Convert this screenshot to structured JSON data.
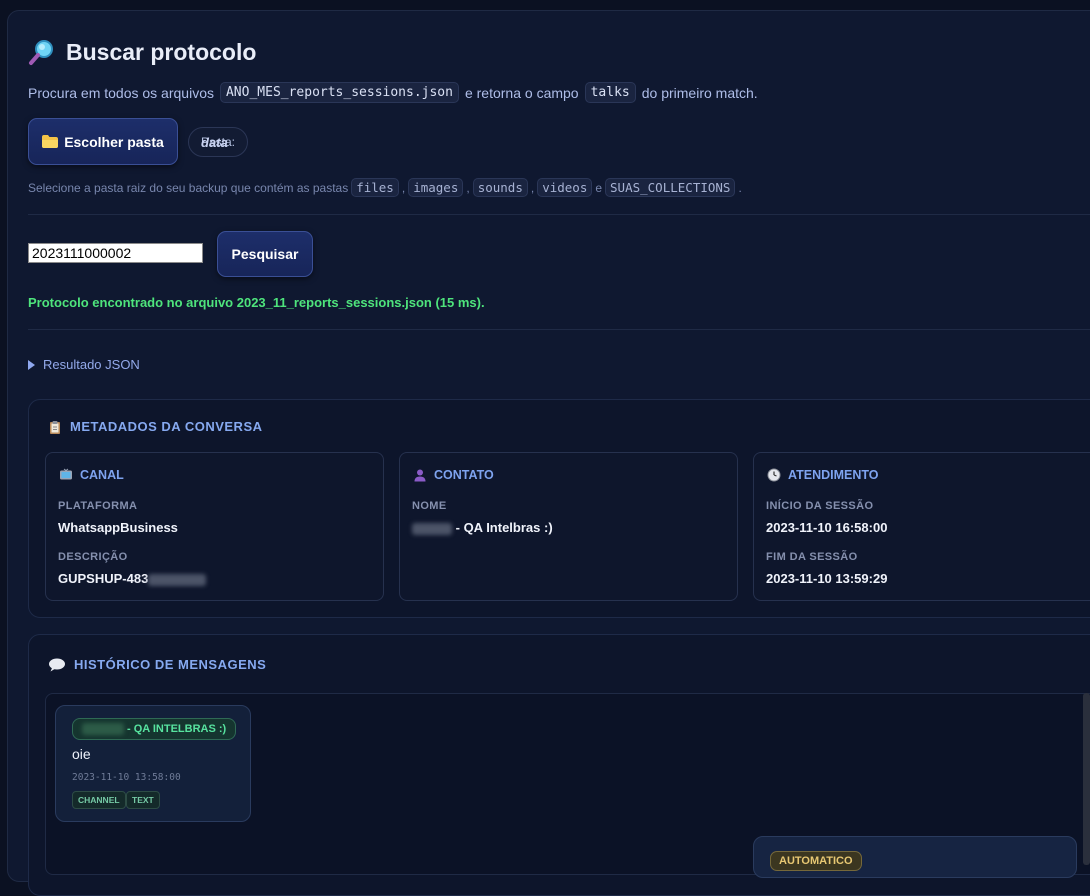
{
  "header": {
    "title": "Buscar protocolo",
    "desc_prefix": "Procura em todos os arquivos",
    "desc_file": "ANO_MES_reports_sessions.json",
    "desc_middle": "e retorna o campo",
    "desc_field": "talks",
    "desc_suffix": "do primeiro match."
  },
  "folder": {
    "button_label": "Escolher pasta",
    "pasta_label": "Pasta:",
    "pasta_value": "data",
    "hint_prefix": "Selecione a pasta raiz do seu backup que contém as pastas",
    "hint_items": [
      "files",
      "images",
      "sounds",
      "videos"
    ],
    "hint_and": "e",
    "hint_last": "SUAS_COLLECTIONS",
    "hint_end": "."
  },
  "search": {
    "value": "2023111000002",
    "button_label": "Pesquisar",
    "status": "Protocolo encontrado no arquivo 2023_11_reports_sessions.json (15 ms)."
  },
  "json_toggle": "Resultado JSON",
  "metadata": {
    "title": "METADADOS DA CONVERSA",
    "canal": {
      "title": "CANAL",
      "plataforma_label": "PLATAFORMA",
      "plataforma_value": "WhatsappBusiness",
      "descricao_label": "DESCRIÇÃO",
      "descricao_value": "GUPSHUP-483"
    },
    "contato": {
      "title": "CONTATO",
      "nome_label": "NOME",
      "nome_value": "- QA Intelbras :)"
    },
    "atendimento": {
      "title": "ATENDIMENTO",
      "inicio_label": "INÍCIO DA SESSÃO",
      "inicio_value": "2023-11-10 16:58:00",
      "fim_label": "FIM DA SESSÃO",
      "fim_value": "2023-11-10 13:59:29"
    }
  },
  "history": {
    "title": "HISTÓRICO DE MENSAGENS",
    "messages": [
      {
        "sender": "- QA INTELBRAS :)",
        "text": "oie",
        "time": "2023-11-10 13:58:00",
        "tags": [
          "CHANNEL",
          "TEXT"
        ]
      },
      {
        "tag": "AUTOMATICO"
      }
    ]
  },
  "colors": {
    "success": "#4ee47c",
    "accent": "#86a9f0",
    "background": "#0b1122"
  }
}
